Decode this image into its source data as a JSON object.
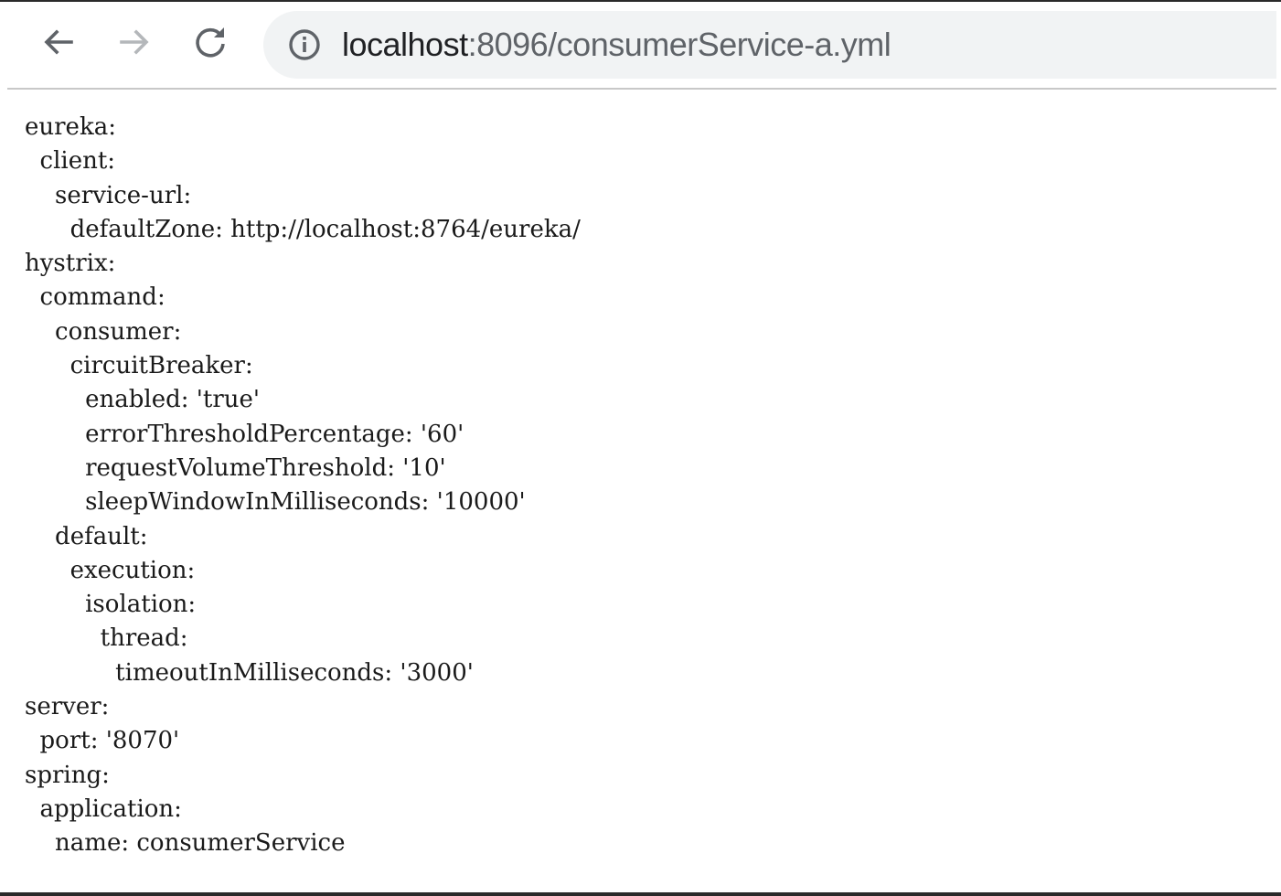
{
  "browser": {
    "url_host": "localhost",
    "url_path": ":8096/consumerService-a.yml",
    "icons": {
      "back": "arrow-left",
      "forward": "arrow-right",
      "reload": "reload",
      "site_info": "info-circle"
    }
  },
  "document": {
    "lines": [
      "eureka:",
      "  client:",
      "    service-url:",
      "      defaultZone: http://localhost:8764/eureka/",
      "hystrix:",
      "  command:",
      "    consumer:",
      "      circuitBreaker:",
      "        enabled: 'true'",
      "        errorThresholdPercentage: '60'",
      "        requestVolumeThreshold: '10'",
      "        sleepWindowInMilliseconds: '10000'",
      "    default:",
      "      execution:",
      "        isolation:",
      "          thread:",
      "            timeoutInMilliseconds: '3000'",
      "server:",
      "  port: '8070'",
      "spring:",
      "  application:",
      "    name: consumerService"
    ]
  }
}
